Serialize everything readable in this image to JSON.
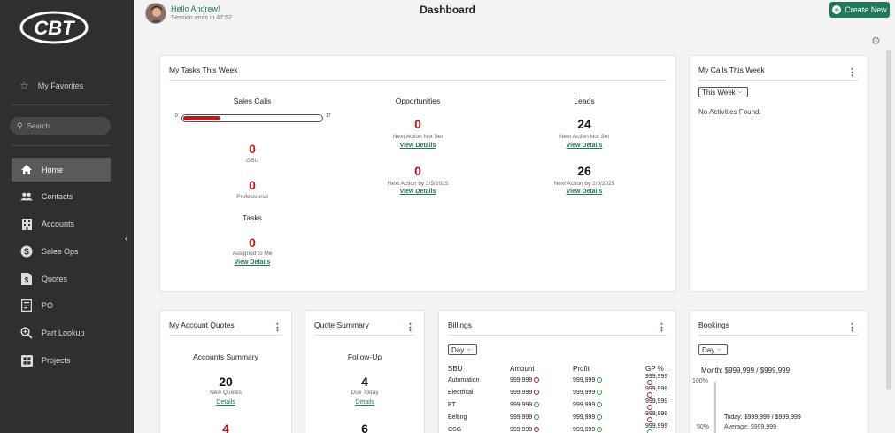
{
  "sidebar": {
    "logo_text": "CBT",
    "favorites_label": "My Favorites",
    "search_placeholder": "Search",
    "items": [
      {
        "label": "Home",
        "icon": "home-icon",
        "active": true
      },
      {
        "label": "Contacts",
        "icon": "contacts-icon"
      },
      {
        "label": "Accounts",
        "icon": "building-icon"
      },
      {
        "label": "Sales Ops",
        "icon": "dollar-icon"
      },
      {
        "label": "Quotes",
        "icon": "quote-doc-icon"
      },
      {
        "label": "PO",
        "icon": "receipt-icon"
      },
      {
        "label": "Part Lookup",
        "icon": "search-plus-icon"
      },
      {
        "label": "Projects",
        "icon": "grid-icon"
      }
    ]
  },
  "header": {
    "greeting": "Hello Andrew!",
    "session": "Session ends in 47:52",
    "title": "Dashboard",
    "create_label": "Create New",
    "accent": "#1f7a5c"
  },
  "tasks": {
    "title": "My Tasks This Week",
    "sales_calls": {
      "title": "Sales Calls",
      "min": "0",
      "max": "17",
      "value": "4",
      "fraction": 0.235,
      "gbu_value": "0",
      "gbu_label": "GBU",
      "pro_value": "0",
      "pro_label": "Professional"
    },
    "tasks_section": {
      "title": "Tasks",
      "value": "0",
      "label": "Assigned to Me",
      "link": "View Details"
    },
    "opportunities": {
      "title": "Opportunities",
      "a_value": "0",
      "a_label": "Next Action Not Set",
      "a_link": "View Details",
      "b_value": "0",
      "b_label": "Next Action by 2/5/2025",
      "b_link": "View Details"
    },
    "leads": {
      "title": "Leads",
      "a_value": "24",
      "a_label": "Next Action Not Set",
      "a_link": "View Details",
      "b_value": "26",
      "b_label": "Next Action by 2/5/2025",
      "b_link": "View Details"
    }
  },
  "calls": {
    "title": "My Calls This Week",
    "filter": "This Week",
    "empty": "No Activities Found."
  },
  "account_quotes": {
    "title": "My Account Quotes",
    "subtitle": "Accounts Summary",
    "value": "20",
    "label": "New Quotes",
    "link": "Details",
    "next_value": "4"
  },
  "quote_summary": {
    "title": "Quote Summary",
    "subtitle": "Follow-Up",
    "value": "4",
    "label": "Due Today",
    "link": "Details",
    "next_value": "6"
  },
  "billings": {
    "title": "Billings",
    "filter": "Day",
    "headers": [
      "SBU",
      "Amount",
      "Profit",
      "GP %"
    ],
    "rows": [
      {
        "sbu": "Automation",
        "amount": "999,999",
        "amount_status": "red",
        "profit": "999,999",
        "profit_status": "green",
        "gp": "999,999",
        "gp_status": "red"
      },
      {
        "sbu": "Electrical",
        "amount": "999,999",
        "amount_status": "red",
        "profit": "999,999",
        "profit_status": "green",
        "gp": "999,999",
        "gp_status": "red"
      },
      {
        "sbu": "PT",
        "amount": "999,999",
        "amount_status": "green",
        "profit": "999,999",
        "profit_status": "green",
        "gp": "999,999",
        "gp_status": "red"
      },
      {
        "sbu": "Belting",
        "amount": "999,999",
        "amount_status": "green",
        "profit": "999,999",
        "profit_status": "green",
        "gp": "999,999",
        "gp_status": "red"
      },
      {
        "sbu": "CSG",
        "amount": "999,999",
        "amount_status": "red",
        "profit": "999,999",
        "profit_status": "green",
        "gp": "999,999",
        "gp_status": "green"
      }
    ]
  },
  "bookings": {
    "title": "Bookings",
    "filter": "Day",
    "month": "Month: $999,999 / $999,999",
    "axis_top": "100%",
    "axis_mid": "50%",
    "today": "Today: $999,999 / $999,999",
    "average": "Average: $999,999"
  }
}
